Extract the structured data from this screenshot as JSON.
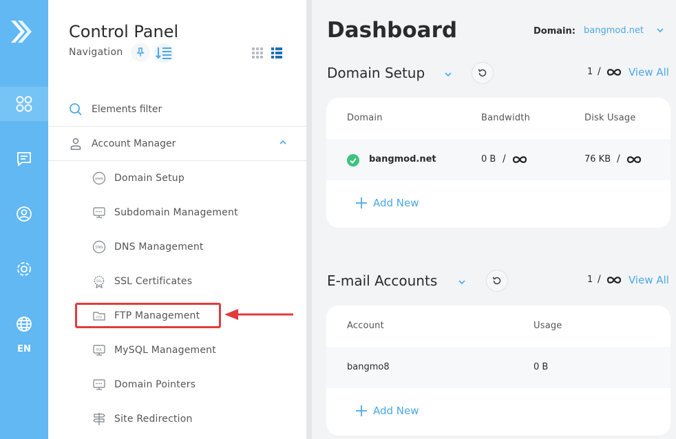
{
  "rail": {
    "lang": "EN"
  },
  "nav": {
    "title": "Control Panel",
    "subtitle": "Navigation",
    "filter_label": "Elements filter",
    "account_manager": "Account Manager",
    "items": [
      {
        "label": "Domain Setup",
        "icon": "www-icon"
      },
      {
        "label": "Subdomain Management",
        "icon": "subdomain-icon"
      },
      {
        "label": "DNS Management",
        "icon": "dns-icon"
      },
      {
        "label": "SSL Certificates",
        "icon": "ssl-icon"
      },
      {
        "label": "FTP Management",
        "icon": "ftp-icon"
      },
      {
        "label": "MySQL Management",
        "icon": "sql-icon"
      },
      {
        "label": "Domain Pointers",
        "icon": "pointer-icon"
      },
      {
        "label": "Site Redirection",
        "icon": "signpost-icon"
      }
    ]
  },
  "main": {
    "title": "Dashboard",
    "domain_label": "Domain:",
    "domain_value": "bangmod.net",
    "domain_setup": {
      "title": "Domain Setup",
      "count": "1",
      "slash": "/",
      "view_all": "View All",
      "columns": [
        "Domain",
        "Bandwidth",
        "Disk Usage"
      ],
      "row": {
        "domain": "bangmod.net",
        "bandwidth": "0 B",
        "disk": "76 KB",
        "slash": "/"
      },
      "add_new": "Add New"
    },
    "email": {
      "title": "E-mail Accounts",
      "count": "1",
      "slash": "/",
      "view_all": "View All",
      "columns": [
        "Account",
        "Usage"
      ],
      "row": {
        "account": "bangmo8",
        "usage": "0 B"
      },
      "add_new": "Add New"
    }
  },
  "colors": {
    "rail": "#62b8f3",
    "accent": "#4aa8e6",
    "highlight": "#e03b3b",
    "success": "#3cc47c"
  }
}
